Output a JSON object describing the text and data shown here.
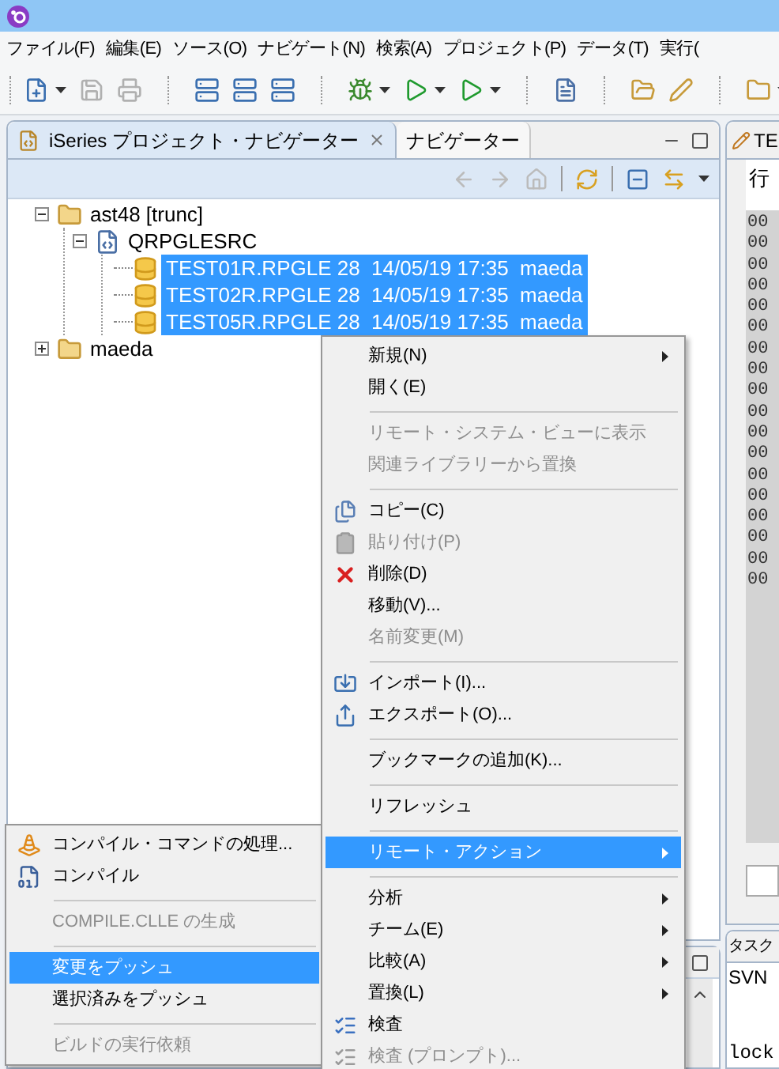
{
  "menu_bar": [
    "ファイル(F)",
    "編集(E)",
    "ソース(O)",
    "ナビゲート(N)",
    "検索(A)",
    "プロジェクト(P)",
    "データ(T)",
    "実行("
  ],
  "navigator": {
    "tabs": [
      {
        "label": "iSeries プロジェクト・ナビゲーター",
        "selected": true,
        "closable": true
      },
      {
        "label": "ナビゲーター",
        "selected": false,
        "closable": false
      }
    ],
    "tree": [
      {
        "label": "ast48 [trunc]",
        "kind": "project",
        "expanded": true,
        "selected": false,
        "children": [
          {
            "label": "QRPGLESRC",
            "kind": "source-file",
            "expanded": true,
            "selected": false,
            "children": [
              {
                "label": "TEST01R.RPGLE 28  14/05/19 17:35  maeda",
                "kind": "member",
                "selected": true
              },
              {
                "label": "TEST02R.RPGLE 28  14/05/19 17:35  maeda",
                "kind": "member",
                "selected": true
              },
              {
                "label": "TEST05R.RPGLE 28  14/05/19 17:35  maeda",
                "kind": "member",
                "selected": true
              }
            ]
          }
        ]
      },
      {
        "label": "maeda",
        "kind": "project",
        "expanded": false,
        "selected": false
      }
    ]
  },
  "editor": {
    "tab": "TE",
    "header": "行",
    "line_numbers": [
      "00",
      "00",
      "00",
      "00",
      "00",
      "00",
      "00",
      "00",
      "00",
      "00",
      "00",
      "00",
      "00",
      "00",
      "00",
      "00",
      "00",
      "00"
    ]
  },
  "tasks": {
    "tab": "タスク",
    "lines": [
      "SVN",
      "lock"
    ]
  },
  "context_menu": {
    "items": [
      {
        "kind": "item",
        "label": "新規(N)",
        "disabled": false,
        "selected": false,
        "submenu": true
      },
      {
        "kind": "item",
        "label": "開く(E)",
        "disabled": false,
        "selected": false,
        "submenu": false
      },
      {
        "kind": "separator"
      },
      {
        "kind": "item",
        "label": "リモート・システム・ビューに表示",
        "disabled": true,
        "selected": false,
        "submenu": false
      },
      {
        "kind": "item",
        "label": "関連ライブラリーから置換",
        "disabled": true,
        "selected": false,
        "submenu": false
      },
      {
        "kind": "separator"
      },
      {
        "kind": "item",
        "label": "コピー(C)",
        "disabled": false,
        "selected": false,
        "submenu": false
      },
      {
        "kind": "item",
        "label": "貼り付け(P)",
        "disabled": true,
        "selected": false,
        "submenu": false
      },
      {
        "kind": "item",
        "label": "削除(D)",
        "disabled": false,
        "selected": false,
        "submenu": false
      },
      {
        "kind": "item",
        "label": "移動(V)...",
        "disabled": false,
        "selected": false,
        "submenu": false
      },
      {
        "kind": "item",
        "label": "名前変更(M)",
        "disabled": true,
        "selected": false,
        "submenu": false
      },
      {
        "kind": "separator"
      },
      {
        "kind": "item",
        "label": "インポート(I)...",
        "disabled": false,
        "selected": false,
        "submenu": false
      },
      {
        "kind": "item",
        "label": "エクスポート(O)...",
        "disabled": false,
        "selected": false,
        "submenu": false
      },
      {
        "kind": "separator"
      },
      {
        "kind": "item",
        "label": "ブックマークの追加(K)...",
        "disabled": false,
        "selected": false,
        "submenu": false
      },
      {
        "kind": "separator"
      },
      {
        "kind": "item",
        "label": "リフレッシュ",
        "disabled": false,
        "selected": false,
        "submenu": false
      },
      {
        "kind": "separator"
      },
      {
        "kind": "item",
        "label": "リモート・アクション",
        "disabled": false,
        "selected": true,
        "submenu": true
      },
      {
        "kind": "separator"
      },
      {
        "kind": "item",
        "label": "分析",
        "disabled": false,
        "selected": false,
        "submenu": true
      },
      {
        "kind": "item",
        "label": "チーム(E)",
        "disabled": false,
        "selected": false,
        "submenu": true
      },
      {
        "kind": "item",
        "label": "比較(A)",
        "disabled": false,
        "selected": false,
        "submenu": true
      },
      {
        "kind": "item",
        "label": "置換(L)",
        "disabled": false,
        "selected": false,
        "submenu": true
      },
      {
        "kind": "item",
        "label": "検査",
        "disabled": false,
        "selected": false,
        "submenu": false
      },
      {
        "kind": "item",
        "label": "検査 (プロンプト)...",
        "disabled": true,
        "selected": false,
        "submenu": false
      }
    ]
  },
  "submenu": {
    "items": [
      {
        "kind": "item",
        "label": "コンパイル・コマンドの処理...",
        "disabled": false,
        "selected": false
      },
      {
        "kind": "item",
        "label": "コンパイル",
        "disabled": false,
        "selected": false
      },
      {
        "kind": "separator"
      },
      {
        "kind": "item",
        "label": "COMPILE.CLLE の生成",
        "disabled": true,
        "selected": false
      },
      {
        "kind": "separator"
      },
      {
        "kind": "item",
        "label": "変更をプッシュ",
        "disabled": false,
        "selected": true
      },
      {
        "kind": "item",
        "label": "選択済みをプッシュ",
        "disabled": false,
        "selected": false
      },
      {
        "kind": "separator"
      },
      {
        "kind": "item",
        "label": "ビルドの実行依頼",
        "disabled": true,
        "selected": false
      }
    ]
  }
}
